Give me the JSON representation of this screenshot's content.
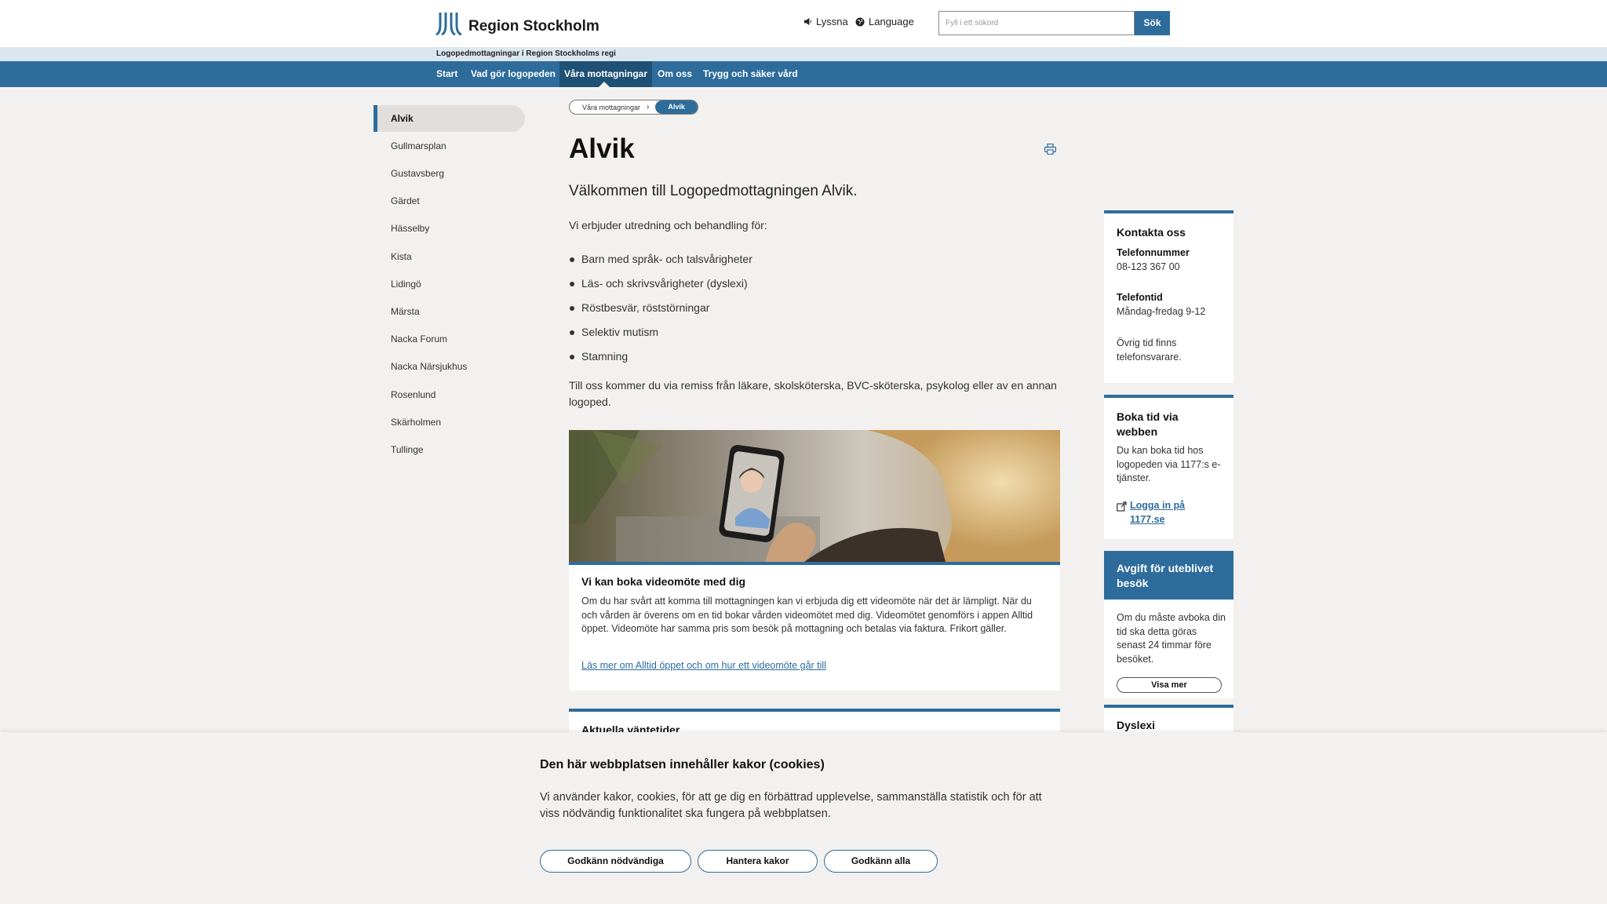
{
  "header": {
    "logo_text": "Region Stockholm",
    "listen_label": "Lyssna",
    "language_label": "Language",
    "search_placeholder": "Fyll i ett sökord",
    "search_button": "Sök"
  },
  "subbar": {
    "text": "Logopedmottagningar i Region Stockholms regi"
  },
  "nav": {
    "items": [
      "Start",
      "Vad gör logopeden",
      "Våra mottagningar",
      "Om oss",
      "Trygg och säker vård"
    ],
    "active": "Våra mottagningar"
  },
  "sidebar": {
    "items": [
      "Alvik",
      "Gullmarsplan",
      "Gustavsberg",
      "Gärdet",
      "Hässelby",
      "Kista",
      "Lidingö",
      "Märsta",
      "Nacka Forum",
      "Nacka Närsjukhus",
      "Rosenlund",
      "Skärholmen",
      "Tullinge"
    ],
    "active": "Alvik"
  },
  "breadcrumb": {
    "parent": "Våra mottagningar",
    "current": "Alvik"
  },
  "main": {
    "title": "Alvik",
    "lead": "Välkommen till Logopedmottagningen Alvik.",
    "intro": "Vi erbjuder utredning och behandling för:",
    "bullets": [
      "Barn med språk- och talsvårigheter",
      "Läs- och skrivsvårigheter (dyslexi)",
      "Röstbesvär, röststörningar",
      "Selektiv mutism",
      "Stamning"
    ],
    "referral": "Till oss kommer du via remiss från läkare, skolsköterska, BVC-sköterska, psykolog eller av en annan logoped."
  },
  "video_card": {
    "title": "Vi kan boka videomöte med dig",
    "body": "Om du har svårt att komma till mottagningen kan vi erbjuda dig ett videomöte när det är lämpligt. När du och vården är överens om en tid bokar vården videomötet med dig. Videomötet genomförs i appen Alltid öppet. Videomöte har samma pris som besök på mottagning och betalas via faktura. Frikort gäller.",
    "link": "Läs mer om Alltid öppet och om hur ett videomöte går till"
  },
  "wait_card": {
    "title": "Aktuella väntetider"
  },
  "contact": {
    "heading": "Kontakta oss",
    "phone_label": "Telefonnummer",
    "phone": "08-123 367 00",
    "hours_label": "Telefontid",
    "hours": "Måndag-fredag 9-12",
    "other": "Övrig tid finns telefonsvarare."
  },
  "booking": {
    "heading": "Boka tid via webben",
    "text": "Du kan boka tid hos logopeden via 1177:s e-tjänster.",
    "link": "Logga in på 1177.se"
  },
  "fee": {
    "heading": "Avgift för uteblivet besök",
    "text": "Om du måste avboka din tid ska detta göras senast 24 timmar före besöket.",
    "button": "Visa mer"
  },
  "dyslexi": {
    "heading": "Dyslexi"
  },
  "cookie": {
    "heading": "Den här webbplatsen innehåller kakor (cookies)",
    "text": "Vi använder kakor, cookies, för att ge dig en förbättrad upplevelse, sammanställa statistik och för att viss nödvändig funktionalitet ska fungera på webbplatsen.",
    "buttons": [
      "Godkänn nödvändiga",
      "Hantera kakor",
      "Godkänn alla"
    ]
  },
  "colors": {
    "brand": "#2e6c9c",
    "brand_dark": "#1f5176",
    "background": "#f3f1ef"
  },
  "icons": [
    "speaker-icon",
    "globe-icon",
    "print-icon",
    "external-link-icon",
    "chevron-right-icon"
  ]
}
